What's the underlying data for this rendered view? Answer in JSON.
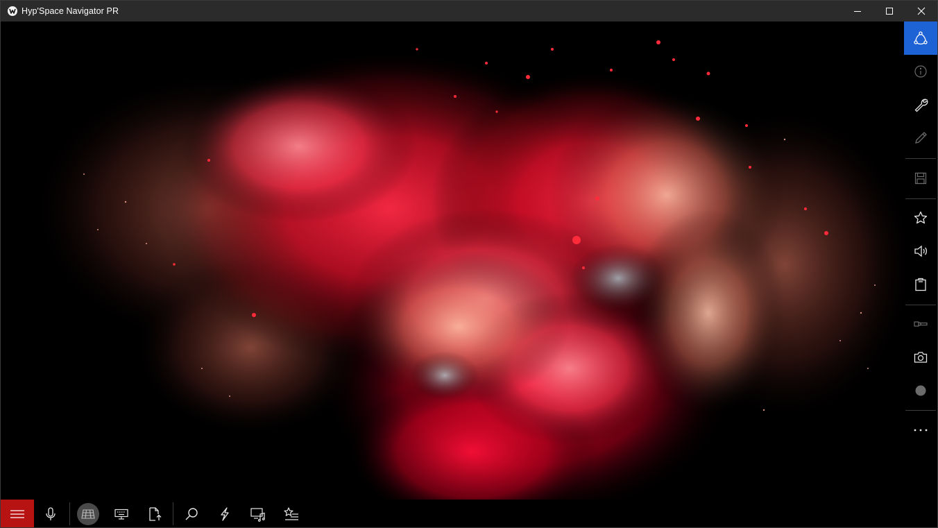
{
  "window": {
    "title": "Hyp'Space Navigator PR"
  },
  "title_controls": [
    "minimize-icon",
    "maximize-icon",
    "close-icon"
  ],
  "sidebar": {
    "items": [
      {
        "name": "network-icon",
        "active": true
      },
      {
        "name": "info-icon"
      },
      {
        "name": "wrench-icon"
      },
      {
        "name": "pencil-icon"
      },
      {
        "name": "save-icon"
      },
      {
        "name": "star-icon"
      },
      {
        "name": "speaker-icon"
      },
      {
        "name": "clipboard-icon"
      },
      {
        "name": "flashlight-icon"
      },
      {
        "name": "camera-icon"
      },
      {
        "name": "record-icon"
      },
      {
        "name": "more-icon"
      }
    ]
  },
  "bottombar": {
    "items": [
      {
        "name": "hamburger-icon"
      },
      {
        "name": "microphone-icon"
      },
      {
        "name": "globe-icon"
      },
      {
        "name": "keyboard-icon"
      },
      {
        "name": "share-file-icon"
      },
      {
        "name": "search-icon"
      },
      {
        "name": "lightning-icon"
      },
      {
        "name": "media-icon"
      },
      {
        "name": "favorites-list-icon"
      }
    ]
  },
  "colors": {
    "titlebar": "#2b2b2b",
    "accent_active": "#1e63d6",
    "menu_button": "#b71313",
    "icon": "#e6e6e6",
    "icon_dim": "#6b6b6b"
  },
  "content": {
    "image": "red-powder-explosion"
  }
}
